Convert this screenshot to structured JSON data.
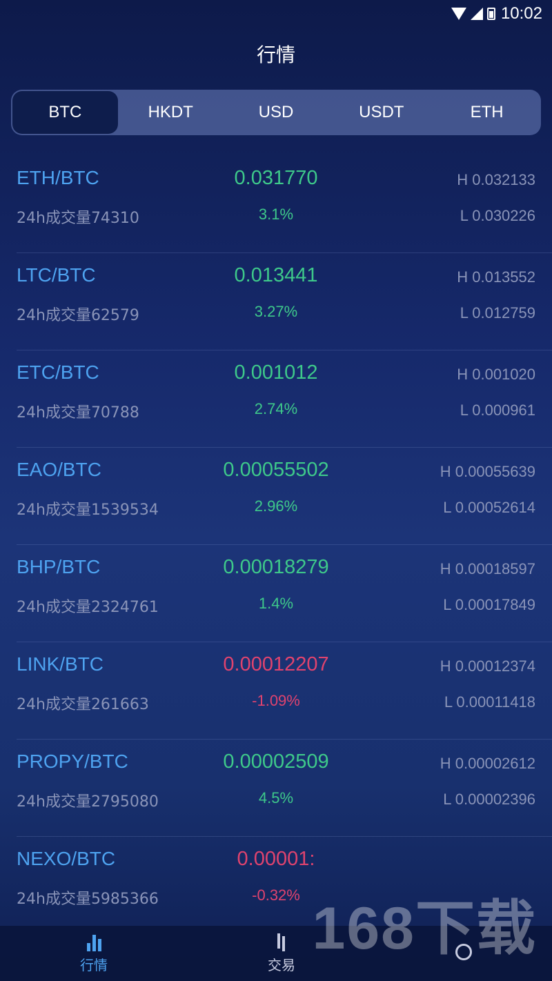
{
  "status_bar": {
    "time": "10:02"
  },
  "header": {
    "title": "行情"
  },
  "tabs": [
    {
      "label": "BTC",
      "active": true
    },
    {
      "label": "HKDT",
      "active": false
    },
    {
      "label": "USD",
      "active": false
    },
    {
      "label": "USDT",
      "active": false
    },
    {
      "label": "ETH",
      "active": false
    }
  ],
  "market": [
    {
      "pair": "ETH/BTC",
      "volume": "24h成交量74310",
      "price": "0.031770",
      "change": "3.1%",
      "high": "H 0.032133",
      "low": "L 0.030226",
      "trend": "up"
    },
    {
      "pair": "LTC/BTC",
      "volume": "24h成交量62579",
      "price": "0.013441",
      "change": "3.27%",
      "high": "H 0.013552",
      "low": "L 0.012759",
      "trend": "up"
    },
    {
      "pair": "ETC/BTC",
      "volume": "24h成交量70788",
      "price": "0.001012",
      "change": "2.74%",
      "high": "H 0.001020",
      "low": "L 0.000961",
      "trend": "up"
    },
    {
      "pair": "EAO/BTC",
      "volume": "24h成交量1539534",
      "price": "0.00055502",
      "change": "2.96%",
      "high": "H 0.00055639",
      "low": "L 0.00052614",
      "trend": "up"
    },
    {
      "pair": "BHP/BTC",
      "volume": "24h成交量2324761",
      "price": "0.00018279",
      "change": "1.4%",
      "high": "H 0.00018597",
      "low": "L 0.00017849",
      "trend": "up"
    },
    {
      "pair": "LINK/BTC",
      "volume": "24h成交量261663",
      "price": "0.00012207",
      "change": "-1.09%",
      "high": "H 0.00012374",
      "low": "L 0.00011418",
      "trend": "down"
    },
    {
      "pair": "PROPY/BTC",
      "volume": "24h成交量2795080",
      "price": "0.00002509",
      "change": "4.5%",
      "high": "H 0.00002612",
      "low": "L 0.00002396",
      "trend": "up"
    },
    {
      "pair": "NEXO/BTC",
      "volume": "24h成交量5985366",
      "price": "0.00001:",
      "change": "-0.32%",
      "high": "",
      "low": "",
      "trend": "down"
    }
  ],
  "bottom_nav": [
    {
      "label": "行情",
      "icon": "bar-chart-icon",
      "active": true
    },
    {
      "label": "交易",
      "icon": "trade-icon",
      "active": false
    },
    {
      "label": "",
      "icon": "user-icon",
      "active": false
    }
  ],
  "watermark": "168下载",
  "colors": {
    "up": "#3ec98a",
    "down": "#e0436e",
    "pair": "#4ea3f0",
    "muted": "#8a94b8"
  }
}
